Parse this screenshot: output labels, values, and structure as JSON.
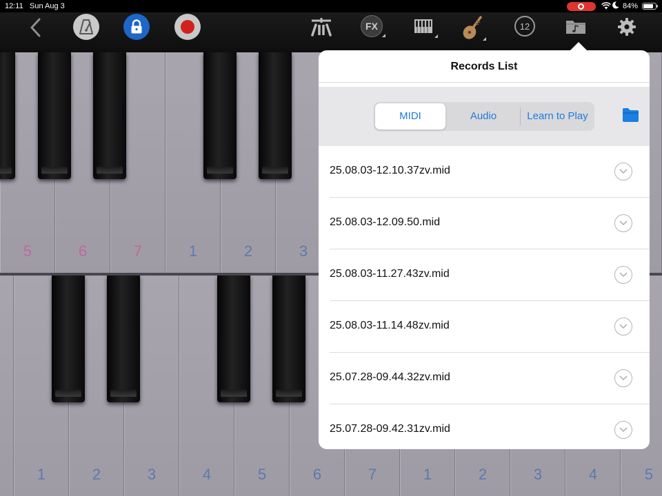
{
  "status_bar": {
    "time": "12:11",
    "date": "Sun Aug 3",
    "battery": "84%",
    "battery_level": 0.84
  },
  "toolbar": {
    "icons": [
      "back-chevron-icon",
      "metronome-icon",
      "lock-icon",
      "record-icon",
      "play-mode-icon",
      "fx-icon",
      "keyboard-icon",
      "pipa-instrument-icon",
      "transpose-icon",
      "records-folder-icon",
      "gear-icon"
    ],
    "fx_label": "FX",
    "transpose_label": "12",
    "colors": {
      "lock": "#1e66c8",
      "record": "#d0221c"
    }
  },
  "piano": {
    "upper_row": {
      "labels": [
        "5",
        "6",
        "7",
        "1",
        "2",
        "3"
      ],
      "label_colors": [
        "#c0689f",
        "#c0689f",
        "#c0689f",
        "#5c79ad",
        "#5c79ad",
        "#5c79ad"
      ]
    },
    "lower_row": {
      "labels": [
        "1",
        "2",
        "3",
        "4",
        "5",
        "6",
        "7",
        "1",
        "2",
        "3",
        "4",
        "5"
      ],
      "label_color": "#5c79ad"
    }
  },
  "records_popover": {
    "title": "Records List",
    "tabs": [
      {
        "label": "MIDI",
        "active": true
      },
      {
        "label": "Audio",
        "active": false
      },
      {
        "label": "Learn to Play",
        "active": false
      }
    ],
    "files": [
      "25.08.03-12.10.37zv.mid",
      "25.08.03-12.09.50.mid",
      "25.08.03-11.27.43zv.mid",
      "25.08.03-11.14.48zv.mid",
      "25.07.28-09.44.32zv.mid",
      "25.07.28-09.42.31zv.mid"
    ]
  }
}
